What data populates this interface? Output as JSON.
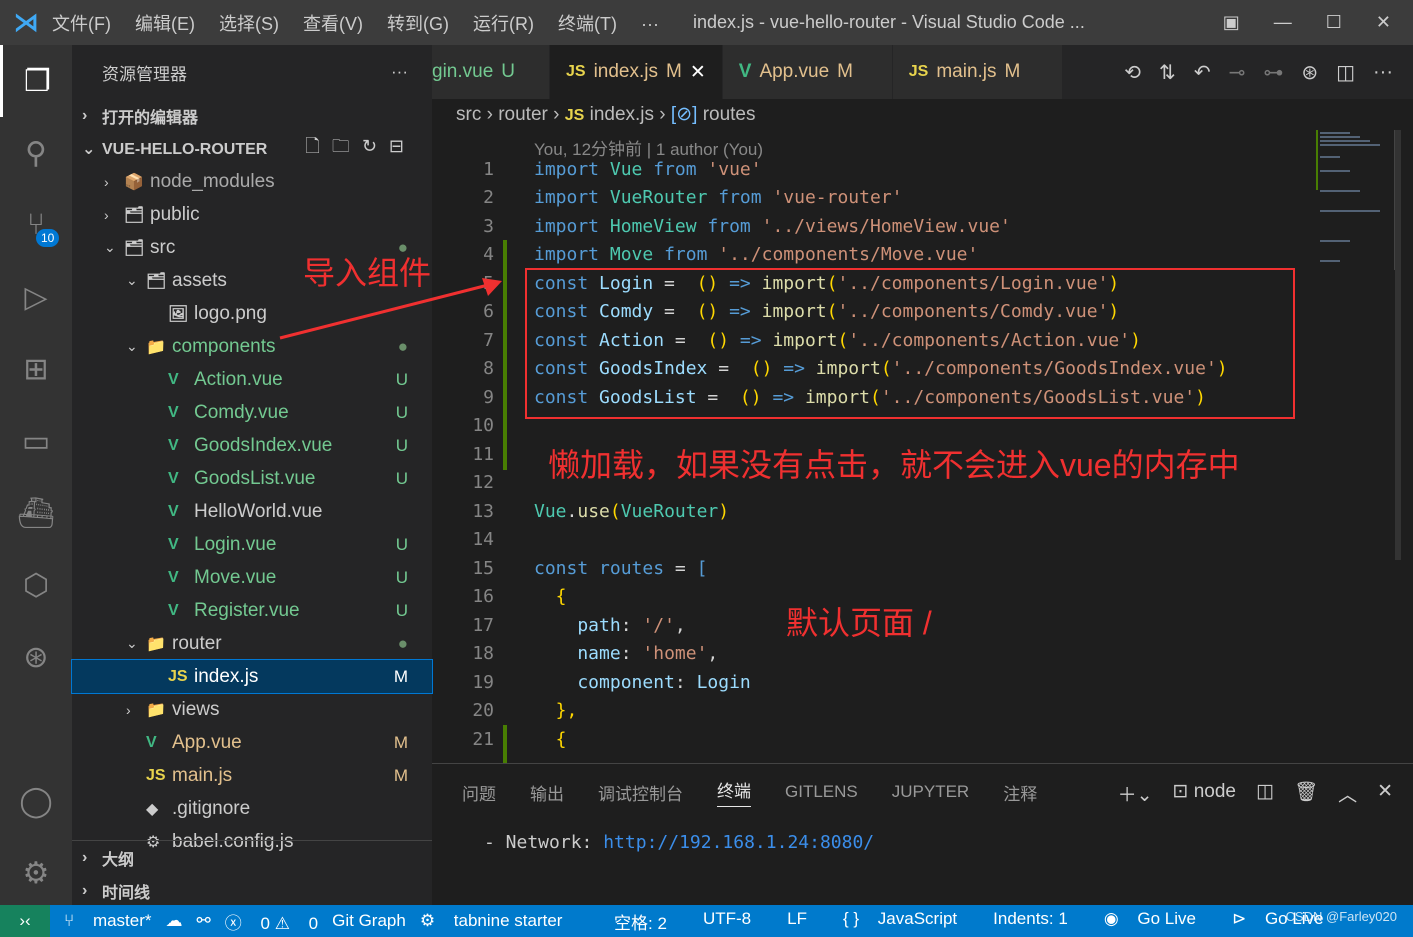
{
  "title": {
    "menus": [
      "文件(F)",
      "编辑(E)",
      "选择(S)",
      "查看(V)",
      "转到(G)",
      "运行(R)",
      "终端(T)",
      "···"
    ],
    "window_title": "index.js - vue-hello-router - Visual Studio Code ..."
  },
  "activity": {
    "scm_badge": "10"
  },
  "explorer": {
    "header": "资源管理器",
    "more": "···",
    "open_editors": "打开的编辑器",
    "project": "VUE-HELLO-ROUTER",
    "outline": "大纲",
    "timeline": "时间线",
    "items": [
      {
        "label": "node_modules",
        "status": ""
      },
      {
        "label": "public",
        "status": ""
      },
      {
        "label": "src",
        "status": "●"
      },
      {
        "label": "assets",
        "status": ""
      },
      {
        "label": "logo.png",
        "status": ""
      },
      {
        "label": "components",
        "status": "●"
      },
      {
        "label": "Action.vue",
        "status": "U"
      },
      {
        "label": "Comdy.vue",
        "status": "U"
      },
      {
        "label": "GoodsIndex.vue",
        "status": "U"
      },
      {
        "label": "GoodsList.vue",
        "status": "U"
      },
      {
        "label": "HelloWorld.vue",
        "status": ""
      },
      {
        "label": "Login.vue",
        "status": "U"
      },
      {
        "label": "Move.vue",
        "status": "U"
      },
      {
        "label": "Register.vue",
        "status": "U"
      },
      {
        "label": "router",
        "status": "●"
      },
      {
        "label": "index.js",
        "status": "M"
      },
      {
        "label": "views",
        "status": ""
      },
      {
        "label": "App.vue",
        "status": "M"
      },
      {
        "label": "main.js",
        "status": "M"
      },
      {
        "label": ".gitignore",
        "status": ""
      },
      {
        "label": "babel.config.js",
        "status": ""
      }
    ]
  },
  "tabs": [
    {
      "label": "gin.vue",
      "status": "U"
    },
    {
      "label": "index.js",
      "status": "M"
    },
    {
      "label": "App.vue",
      "status": "M"
    },
    {
      "label": "main.js",
      "status": "M"
    }
  ],
  "breadcrumb": [
    "src",
    "router",
    "index.js",
    "routes"
  ],
  "blame": "You, 12分钟前 | 1 author (You)",
  "code": [
    [
      [
        "import",
        "k"
      ],
      [
        " Vue ",
        "c"
      ],
      [
        "from",
        "k"
      ],
      [
        " 'vue'",
        "s"
      ]
    ],
    [
      [
        "import",
        "k"
      ],
      [
        " VueRouter ",
        "c"
      ],
      [
        "from",
        "k"
      ],
      [
        " 'vue-router'",
        "s"
      ]
    ],
    [
      [
        "import",
        "k"
      ],
      [
        " HomeView ",
        "c"
      ],
      [
        "from",
        "k"
      ],
      [
        " '../views/HomeView.vue'",
        "s"
      ]
    ],
    [
      [
        "import",
        "k"
      ],
      [
        " Move ",
        "c"
      ],
      [
        "from",
        "k"
      ],
      [
        " '../components/Move.vue'",
        "s"
      ]
    ],
    [
      [
        "const",
        "k"
      ],
      [
        " Login ",
        "v"
      ],
      [
        "=  ",
        "p"
      ],
      [
        "()",
        "y"
      ],
      [
        " => ",
        "k"
      ],
      [
        "import",
        "f"
      ],
      [
        "(",
        "y"
      ],
      [
        "'../components/Login.vue'",
        "s"
      ],
      [
        ")",
        "y"
      ]
    ],
    [
      [
        "const",
        "k"
      ],
      [
        " Comdy ",
        "v"
      ],
      [
        "=  ",
        "p"
      ],
      [
        "()",
        "y"
      ],
      [
        " => ",
        "k"
      ],
      [
        "import",
        "f"
      ],
      [
        "(",
        "y"
      ],
      [
        "'../components/Comdy.vue'",
        "s"
      ],
      [
        ")",
        "y"
      ]
    ],
    [
      [
        "const",
        "k"
      ],
      [
        " Action ",
        "v"
      ],
      [
        "=  ",
        "p"
      ],
      [
        "()",
        "y"
      ],
      [
        " => ",
        "k"
      ],
      [
        "import",
        "f"
      ],
      [
        "(",
        "y"
      ],
      [
        "'../components/Action.vue'",
        "s"
      ],
      [
        ")",
        "y"
      ]
    ],
    [
      [
        "const",
        "k"
      ],
      [
        " GoodsIndex ",
        "v"
      ],
      [
        "=  ",
        "p"
      ],
      [
        "()",
        "y"
      ],
      [
        " => ",
        "k"
      ],
      [
        "import",
        "f"
      ],
      [
        "(",
        "y"
      ],
      [
        "'../components/GoodsIndex.vue'",
        "s"
      ],
      [
        ")",
        "y"
      ]
    ],
    [
      [
        "const",
        "k"
      ],
      [
        " GoodsList ",
        "v"
      ],
      [
        "=  ",
        "p"
      ],
      [
        "()",
        "y"
      ],
      [
        " => ",
        "k"
      ],
      [
        "import",
        "f"
      ],
      [
        "(",
        "y"
      ],
      [
        "'../components/GoodsList.vue'",
        "s"
      ],
      [
        ")",
        "y"
      ]
    ],
    [],
    [],
    [],
    [
      [
        "Vue",
        "c"
      ],
      [
        ".",
        "p"
      ],
      [
        "use",
        "f"
      ],
      [
        "(",
        "y"
      ],
      [
        "VueRouter",
        "c"
      ],
      [
        ")",
        "y"
      ]
    ],
    [],
    [
      [
        "const",
        "k"
      ],
      [
        " routes ",
        "k"
      ],
      [
        "= ",
        "p"
      ],
      [
        "[",
        "k"
      ]
    ],
    [
      [
        "  {",
        "y"
      ]
    ],
    [
      [
        "    path",
        "v"
      ],
      [
        ": ",
        "p"
      ],
      [
        "'/'",
        "s"
      ],
      [
        ",",
        "p"
      ]
    ],
    [
      [
        "    name",
        "v"
      ],
      [
        ": ",
        "p"
      ],
      [
        "'home'",
        "s"
      ],
      [
        ",",
        "p"
      ]
    ],
    [
      [
        "    component",
        "v"
      ],
      [
        ": ",
        "p"
      ],
      [
        "Login",
        "v"
      ]
    ],
    [
      [
        "  },",
        "y"
      ]
    ],
    [
      [
        "  {",
        "y"
      ]
    ]
  ],
  "annotations": {
    "import": "导入组件",
    "lazy": "懒加载，如果没有点击，就不会进入vue的内存中",
    "default": "默认页面 /"
  },
  "panel": {
    "tabs": [
      "问题",
      "输出",
      "调试控制台",
      "终端",
      "GITLENS",
      "JUPYTER",
      "注释"
    ],
    "active": "终端",
    "shell": "node",
    "terminal_label": "- Network: ",
    "terminal_url": "http://192.168.1.24:8080/"
  },
  "status": {
    "branch": "master*",
    "errors": "0",
    "warnings": "0",
    "git_graph": "Git Graph",
    "tabnine": "tabnine starter",
    "spaces": "空格: 2",
    "encoding": "UTF-8",
    "eol": "LF",
    "language": "JavaScript",
    "indents": "Indents: 1",
    "golive1": "Go Live",
    "golive2": "Go Live",
    "watermark": "CSDN @Farley020"
  }
}
